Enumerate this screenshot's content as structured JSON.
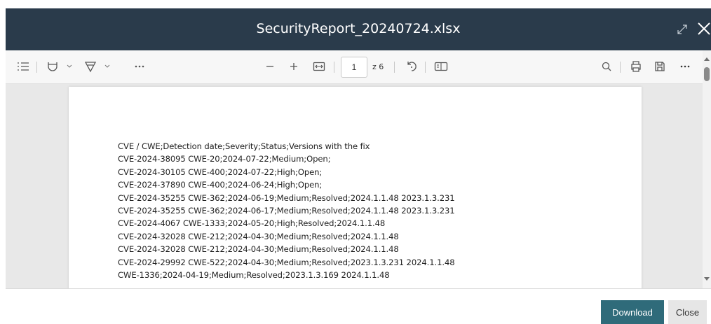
{
  "window": {
    "title": "SecurityReport_20240724.xlsx"
  },
  "toolbar": {
    "page_number": "1",
    "page_total": "z 6"
  },
  "document": {
    "lines": [
      "CVE / CWE;Detection date;Severity;Status;Versions with the fix",
      "CVE-2024-38095 CWE-20;2024-07-22;Medium;Open;",
      "CVE-2024-30105 CWE-400;2024-07-22;High;Open;",
      "CVE-2024-37890 CWE-400;2024-06-24;High;Open;",
      "CVE-2024-35255 CWE-362;2024-06-19;Medium;Resolved;2024.1.1.48 2023.1.3.231",
      "CVE-2024-35255 CWE-362;2024-06-17;Medium;Resolved;2024.1.1.48 2023.1.3.231",
      "CVE-2024-4067 CWE-1333;2024-05-20;High;Resolved;2024.1.1.48",
      "CVE-2024-32028 CWE-212;2024-04-30;Medium;Resolved;2024.1.1.48",
      "CVE-2024-32028 CWE-212;2024-04-30;Medium;Resolved;2024.1.1.48",
      "CVE-2024-29992 CWE-522;2024-04-30;Medium;Resolved;2023.1.3.231 2024.1.1.48",
      "CWE-1336;2024-04-19;Medium;Resolved;2023.1.3.169 2024.1.1.48"
    ]
  },
  "footer": {
    "download_label": "Download",
    "close_label": "Close"
  },
  "colors": {
    "titlebar": "#2a3b4b",
    "download_button": "#2f6b7a"
  }
}
